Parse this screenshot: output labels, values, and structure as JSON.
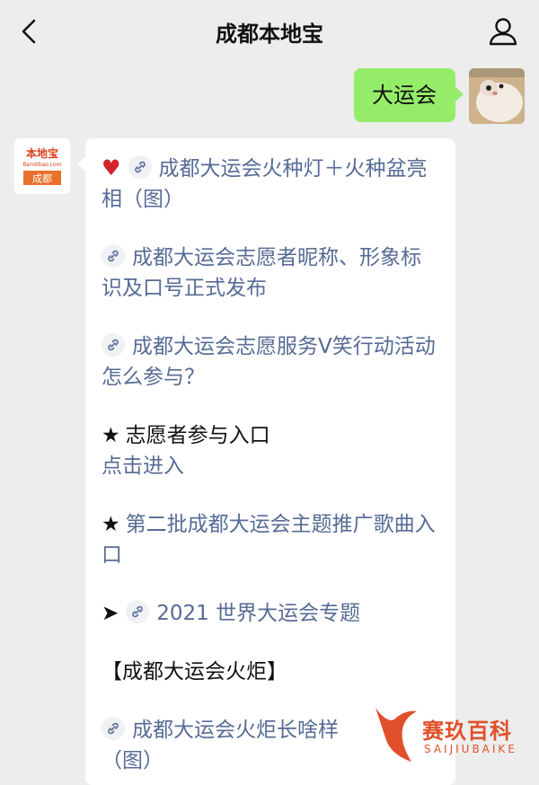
{
  "header": {
    "title": "成都本地宝"
  },
  "outgoing": {
    "text": "大运会"
  },
  "bot": {
    "avatar_top": "本地宝",
    "avatar_domain": "Bendibao.com",
    "avatar_city": "成都"
  },
  "message": {
    "item1": "成都大运会火种灯＋火种盆亮相（图）",
    "item2": "成都大运会志愿者昵称、形象标识及口号正式发布",
    "item3": "成都大运会志愿服务Ⅴ笑行动活动怎么参与？",
    "item4_label": "志愿者参与入口",
    "item4_link": "点击进入",
    "item5": "第二批成都大运会主题推广歌曲入口",
    "item6": "2021 世界大运会专题",
    "section_title": "【成都大运会火炬】",
    "item7_line1": "成都大运会火炬长啥样",
    "item7_line2": "（图）"
  },
  "watermark": {
    "title": "赛玖百科",
    "subtitle": "SAIJIUBAIKE"
  },
  "colors": {
    "link": "#576b95",
    "bubble_green": "#95ec69",
    "heart": "#d3242c",
    "brand_orange": "#e1502a"
  }
}
